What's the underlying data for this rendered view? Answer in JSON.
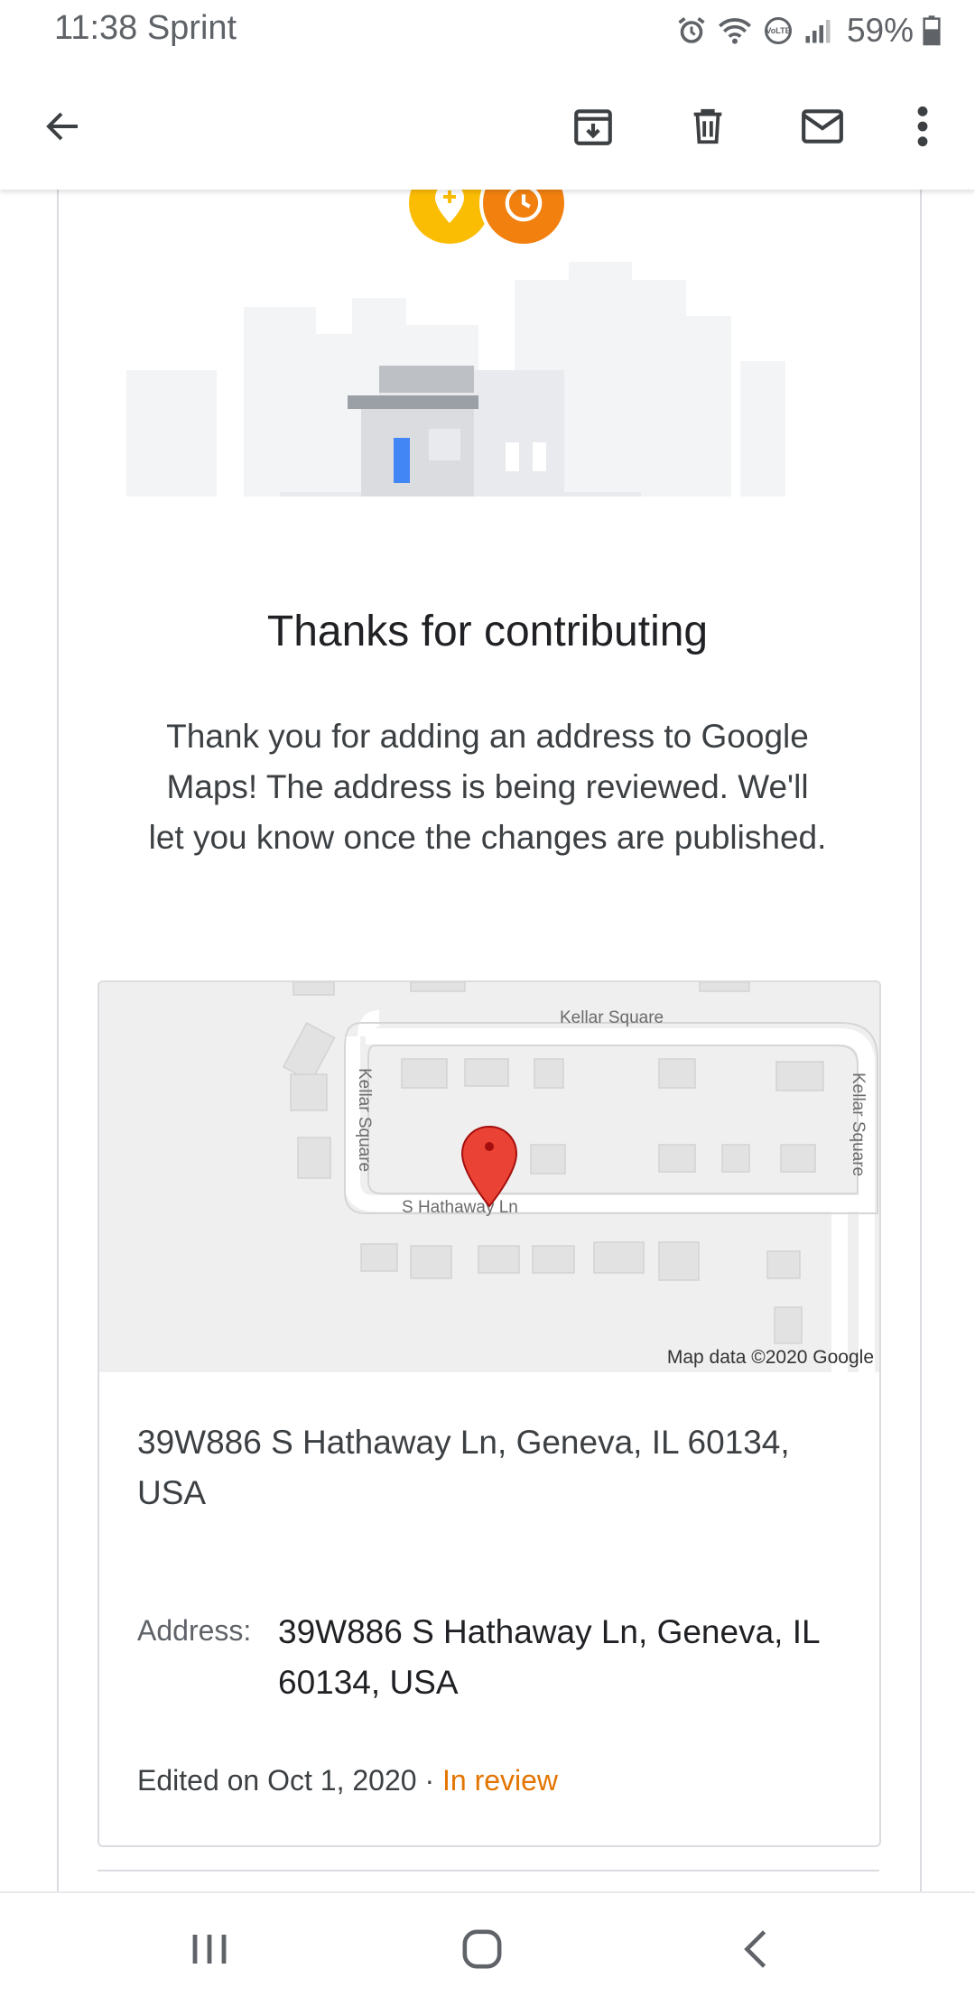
{
  "status_bar": {
    "time_carrier": "11:38 Sprint",
    "battery": "59%",
    "icons": [
      "alarm-icon",
      "wifi-icon",
      "volte-icon",
      "signal-icon",
      "battery-icon"
    ]
  },
  "app_bar": {
    "icons": [
      "back-arrow-icon",
      "archive-icon",
      "delete-icon",
      "mail-icon",
      "more-vert-icon"
    ]
  },
  "email": {
    "heading": "Thanks for contributing",
    "body": "Thank you for adding an address to Google Maps! The address is being reviewed. We'll let you know once the changes are published.",
    "map": {
      "street_top": "Kellar Square",
      "street_left": "Kellar Square",
      "street_right": "Kellar Square",
      "street_bottom": "S Hathaway Ln",
      "attribution": "Map data ©2020 Google"
    },
    "address_main": "39W886 S Hathaway Ln, Geneva, IL 60134, USA",
    "address_label": "Address:",
    "address_value": "39W886 S Hathaway Ln, Geneva, IL 60134, USA",
    "edited_text": "Edited on Oct 1, 2020 · ",
    "status": "In review"
  },
  "colors": {
    "accent_orange": "#e37400",
    "pin_yellow": "#fbbc04",
    "clock_orange": "#f2800f",
    "map_pin_red": "#ea4335"
  }
}
